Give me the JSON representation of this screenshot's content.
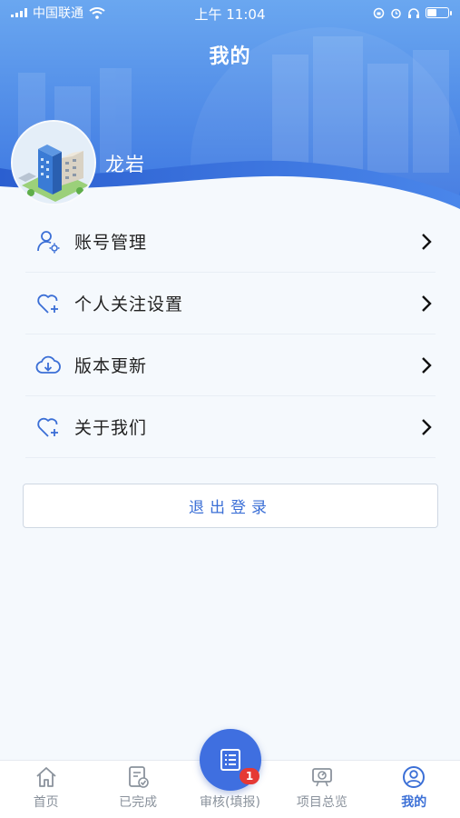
{
  "status_bar": {
    "carrier": "中国联通",
    "time": "上午 11:04"
  },
  "header": {
    "title": "我的",
    "user_name": "龙岩"
  },
  "menu": {
    "items": [
      {
        "label": "账号管理",
        "icon": "user-settings-icon"
      },
      {
        "label": "个人关注设置",
        "icon": "heart-plus-icon"
      },
      {
        "label": "版本更新",
        "icon": "cloud-download-icon"
      },
      {
        "label": "关于我们",
        "icon": "heart-plus-icon"
      }
    ]
  },
  "logout_label": "退出登录",
  "tabbar": {
    "tabs": [
      {
        "label": "首页",
        "icon": "home-icon"
      },
      {
        "label": "已完成",
        "icon": "document-check-icon"
      },
      {
        "label": "审核(填报)",
        "icon": "list-icon",
        "badge": "1"
      },
      {
        "label": "项目总览",
        "icon": "presentation-icon"
      },
      {
        "label": "我的",
        "icon": "user-circle-icon",
        "active": true
      }
    ]
  },
  "colors": {
    "primary": "#3b6fd6",
    "header_gradient_top": "#3d7be6",
    "header_gradient_bottom": "#6fa8f0",
    "badge": "#e53935"
  }
}
